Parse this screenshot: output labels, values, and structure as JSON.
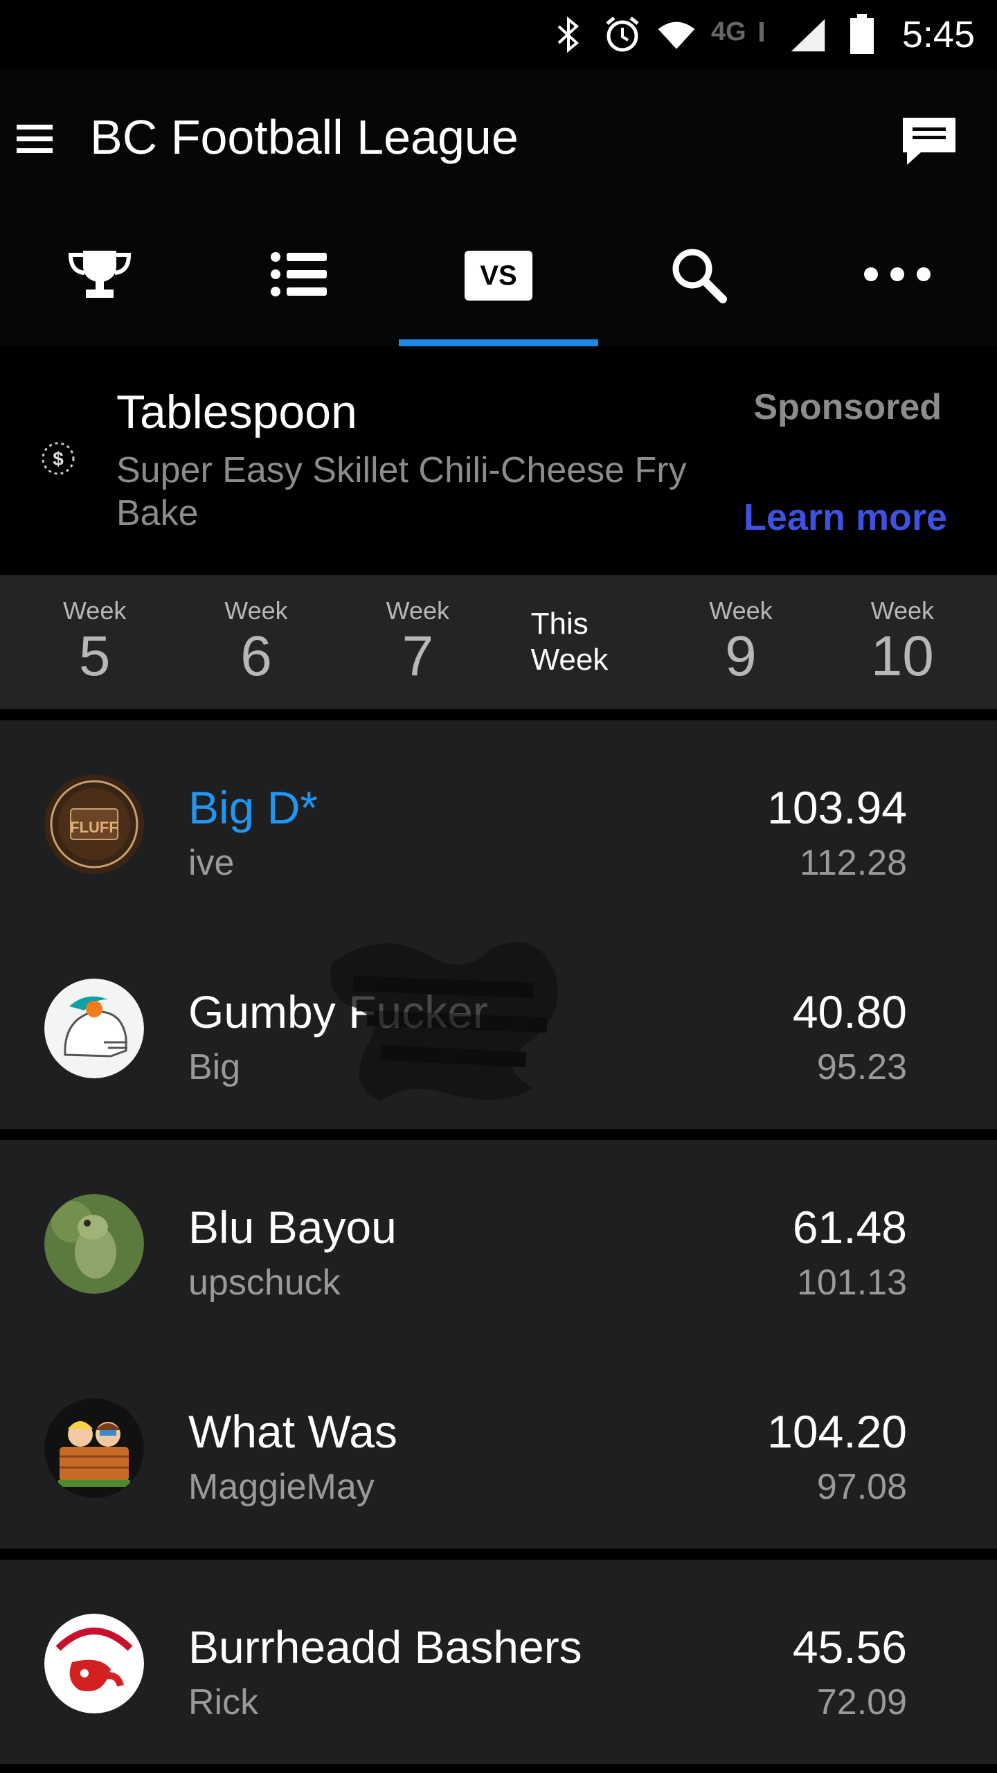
{
  "status_bar": {
    "time": "5:45",
    "icons": [
      "bluetooth-icon",
      "alarm-icon",
      "wifi-icon",
      "4g-lte-icon",
      "signal-icon",
      "battery-icon"
    ],
    "network_label": "4G"
  },
  "app_bar": {
    "title": "BC Football League",
    "icons": [
      "menu-icon",
      "chat-icon"
    ]
  },
  "tabs": [
    {
      "name": "tab-trophy",
      "icon": "trophy-icon"
    },
    {
      "name": "tab-list",
      "icon": "list-icon"
    },
    {
      "name": "tab-vs",
      "label": "VS",
      "active": true
    },
    {
      "name": "tab-search",
      "icon": "search-icon"
    },
    {
      "name": "tab-more",
      "icon": "more-icon"
    }
  ],
  "ad": {
    "title": "Tablespoon",
    "description": "Super Easy Skillet Chili-Cheese Fry Bake",
    "sponsored": "Sponsored",
    "cta": "Learn more"
  },
  "weeks": [
    {
      "label": "Week",
      "number": "5"
    },
    {
      "label": "Week",
      "number": "6"
    },
    {
      "label": "Week",
      "number": "7"
    },
    {
      "label": "This Week",
      "number": "",
      "current": true
    },
    {
      "label": "Week",
      "number": "9"
    },
    {
      "label": "Week",
      "number": "10"
    }
  ],
  "matchups": [
    [
      {
        "team": "Big D*",
        "owner": "ive",
        "score": "103.94",
        "projected": "112.28",
        "mine": true,
        "avatar": "fluff-logo"
      },
      {
        "team": "Gumby Fucker",
        "owner": "Big",
        "score": "40.80",
        "projected": "95.23",
        "avatar": "dolphins-helmet"
      }
    ],
    [
      {
        "team": "Blu Bayou",
        "owner": "upschuck",
        "score": "61.48",
        "projected": "101.13",
        "avatar": "frog-photo"
      },
      {
        "team": "What Was",
        "owner": "MaggieMay",
        "score": "104.20",
        "projected": "97.08",
        "avatar": "hot-tub-cartoon"
      }
    ],
    [
      {
        "team": "Burrheadd Bashers",
        "owner": "Rick",
        "score": "45.56",
        "projected": "72.09",
        "avatar": "bashers-logo"
      }
    ]
  ],
  "colors": {
    "accent": "#1e88e5",
    "my_team": "#2196f3",
    "learn_more": "#3f51e0",
    "card_bg": "#1d1f21",
    "week_bar_bg": "#232425"
  }
}
